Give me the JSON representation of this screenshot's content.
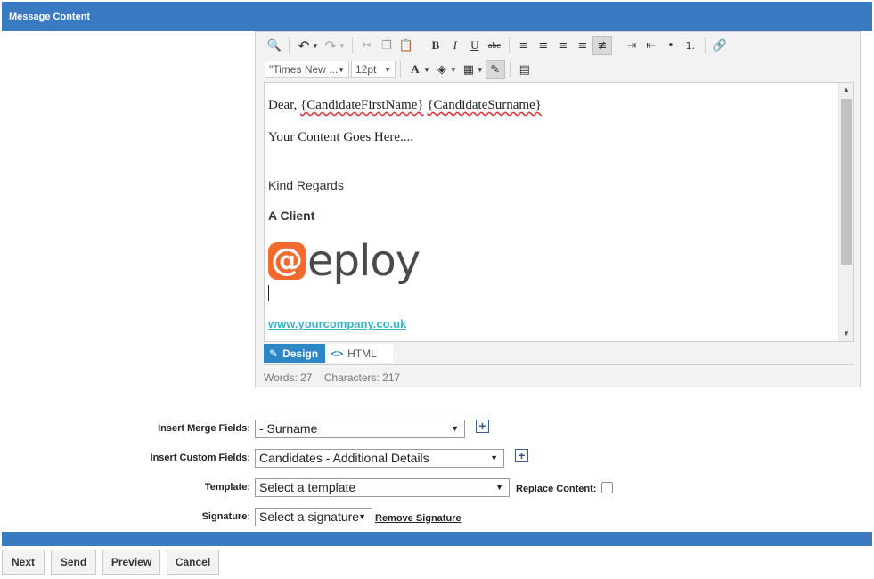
{
  "header": {
    "title": "Message Content"
  },
  "editor": {
    "toolbar": {
      "font_family": "\"Times New ...",
      "font_size": "12pt"
    },
    "content": {
      "greeting_prefix": "Dear,",
      "merge_first_name": "{CandidateFirstName}",
      "merge_surname": "{CandidateSurname}",
      "body": "Your Content Goes Here....",
      "closing": "Kind Regards",
      "signer": "A Client",
      "logo_text": "eploy",
      "website": "www.yourcompany.co.uk"
    },
    "modes": {
      "design": "Design",
      "html": "HTML"
    },
    "stats": {
      "words": "Words: 27",
      "characters": "Characters: 217"
    }
  },
  "form": {
    "merge_fields": {
      "label": "Insert Merge Fields:",
      "value": "- Surname"
    },
    "custom_fields": {
      "label": "Insert Custom Fields:",
      "value": "Candidates - Additional Details"
    },
    "template": {
      "label": "Template:",
      "value": "Select a template",
      "replace_label": "Replace Content:"
    },
    "signature": {
      "label": "Signature:",
      "value": "Select a signature",
      "remove_label": "Remove Signature"
    }
  },
  "actions": {
    "next": "Next",
    "send": "Send",
    "preview": "Preview",
    "cancel": "Cancel"
  },
  "colors": {
    "header_blue": "#3a7ac2",
    "design_tab": "#2e86c6",
    "link": "#3bb3c3",
    "logo_orange": "#f26a2e"
  }
}
